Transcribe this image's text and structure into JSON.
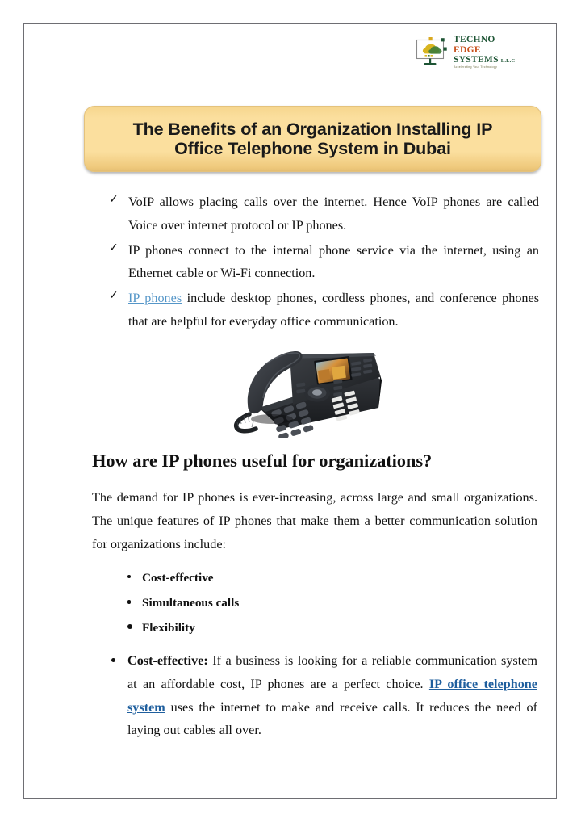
{
  "document": {
    "logo": {
      "icon_name": "monitor-cloud-logo-icon",
      "line1": "TECHNO",
      "line2": "EDGE",
      "line3": "SYSTEMS",
      "suffix": "L.L.C",
      "tagline": "Accelerating Your Technology",
      "color_line1": "#1d5434",
      "color_line2": "#c8501b",
      "color_line3": "#1d5434"
    },
    "title": {
      "line1": "The Benefits of an Organization Installing IP",
      "line2": "Office Telephone System in Dubai",
      "background_start": "#fbdf9e",
      "background_end": "#e3bd72"
    },
    "check_list": {
      "bullet_glyph": "✓",
      "items": [
        {
          "text_before": "VoIP allows placing calls over the internet. Hence VoIP phones are called Voice over internet protocol or IP phones.",
          "link": "",
          "text_after": ""
        },
        {
          "text_before": "IP phones connect to the internal phone service via the internet, using an Ethernet cable or Wi-Fi connection.",
          "link": "",
          "text_after": ""
        },
        {
          "text_before": "",
          "link": "IP phones",
          "text_after": " include desktop phones, cordless phones, and conference phones that are helpful for everyday office communication."
        }
      ],
      "link_color": "#5596c8"
    },
    "figure": {
      "alt": "Black desktop IP office telephone with handset, color display and keypad",
      "icon_name": "ip-desk-phone-image"
    },
    "heading": "How are IP phones useful for organizations?",
    "intro_paragraph": "The demand for IP phones is ever-increasing, across large and small organizations. The unique features of IP phones that make them a better communication solution for organizations include:",
    "feature_list": [
      "Cost-effective",
      "Simultaneous calls",
      "Flexibility"
    ],
    "detail_paragraph": {
      "lead": "Cost-effective:",
      "text_before": " If a business is looking for a reliable communication system at an affordable cost, IP phones are a perfect choice. ",
      "link": "IP office telephone system",
      "text_after": " uses the internet to make and receive calls. It reduces the need of laying out cables all over.",
      "link_color": "#1f5f9e"
    }
  }
}
